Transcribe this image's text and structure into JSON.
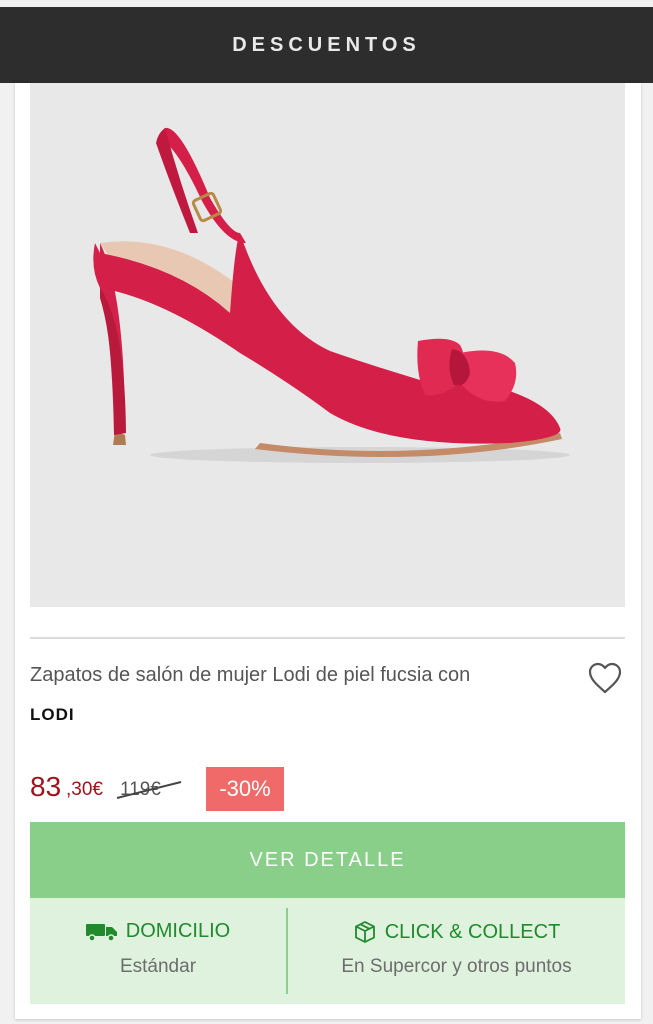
{
  "header": {
    "title": "DESCUENTOS"
  },
  "product": {
    "image_alt": "Zapato de salón fucsia con lazo",
    "title": "Zapatos de salón de mujer Lodi de piel fucsia con",
    "brand": "LODI",
    "price_integer": "83",
    "price_decimal": ",30€",
    "old_price": "119€",
    "discount": "-30%",
    "cta_label": "VER DETALLE"
  },
  "delivery": {
    "home": {
      "label": "DOMICILIO",
      "sub": "Estándar",
      "icon": "truck-icon"
    },
    "collect": {
      "label": "CLICK & COLLECT",
      "sub": "En Supercor y otros puntos",
      "icon": "box-icon"
    }
  },
  "colors": {
    "header_bg": "#2d2d2d",
    "price": "#a0131d",
    "discount_bg": "#f06a6a",
    "cta_bg": "#89cf8a",
    "delivery_bg": "#dff2de",
    "delivery_text": "#208a2c"
  }
}
